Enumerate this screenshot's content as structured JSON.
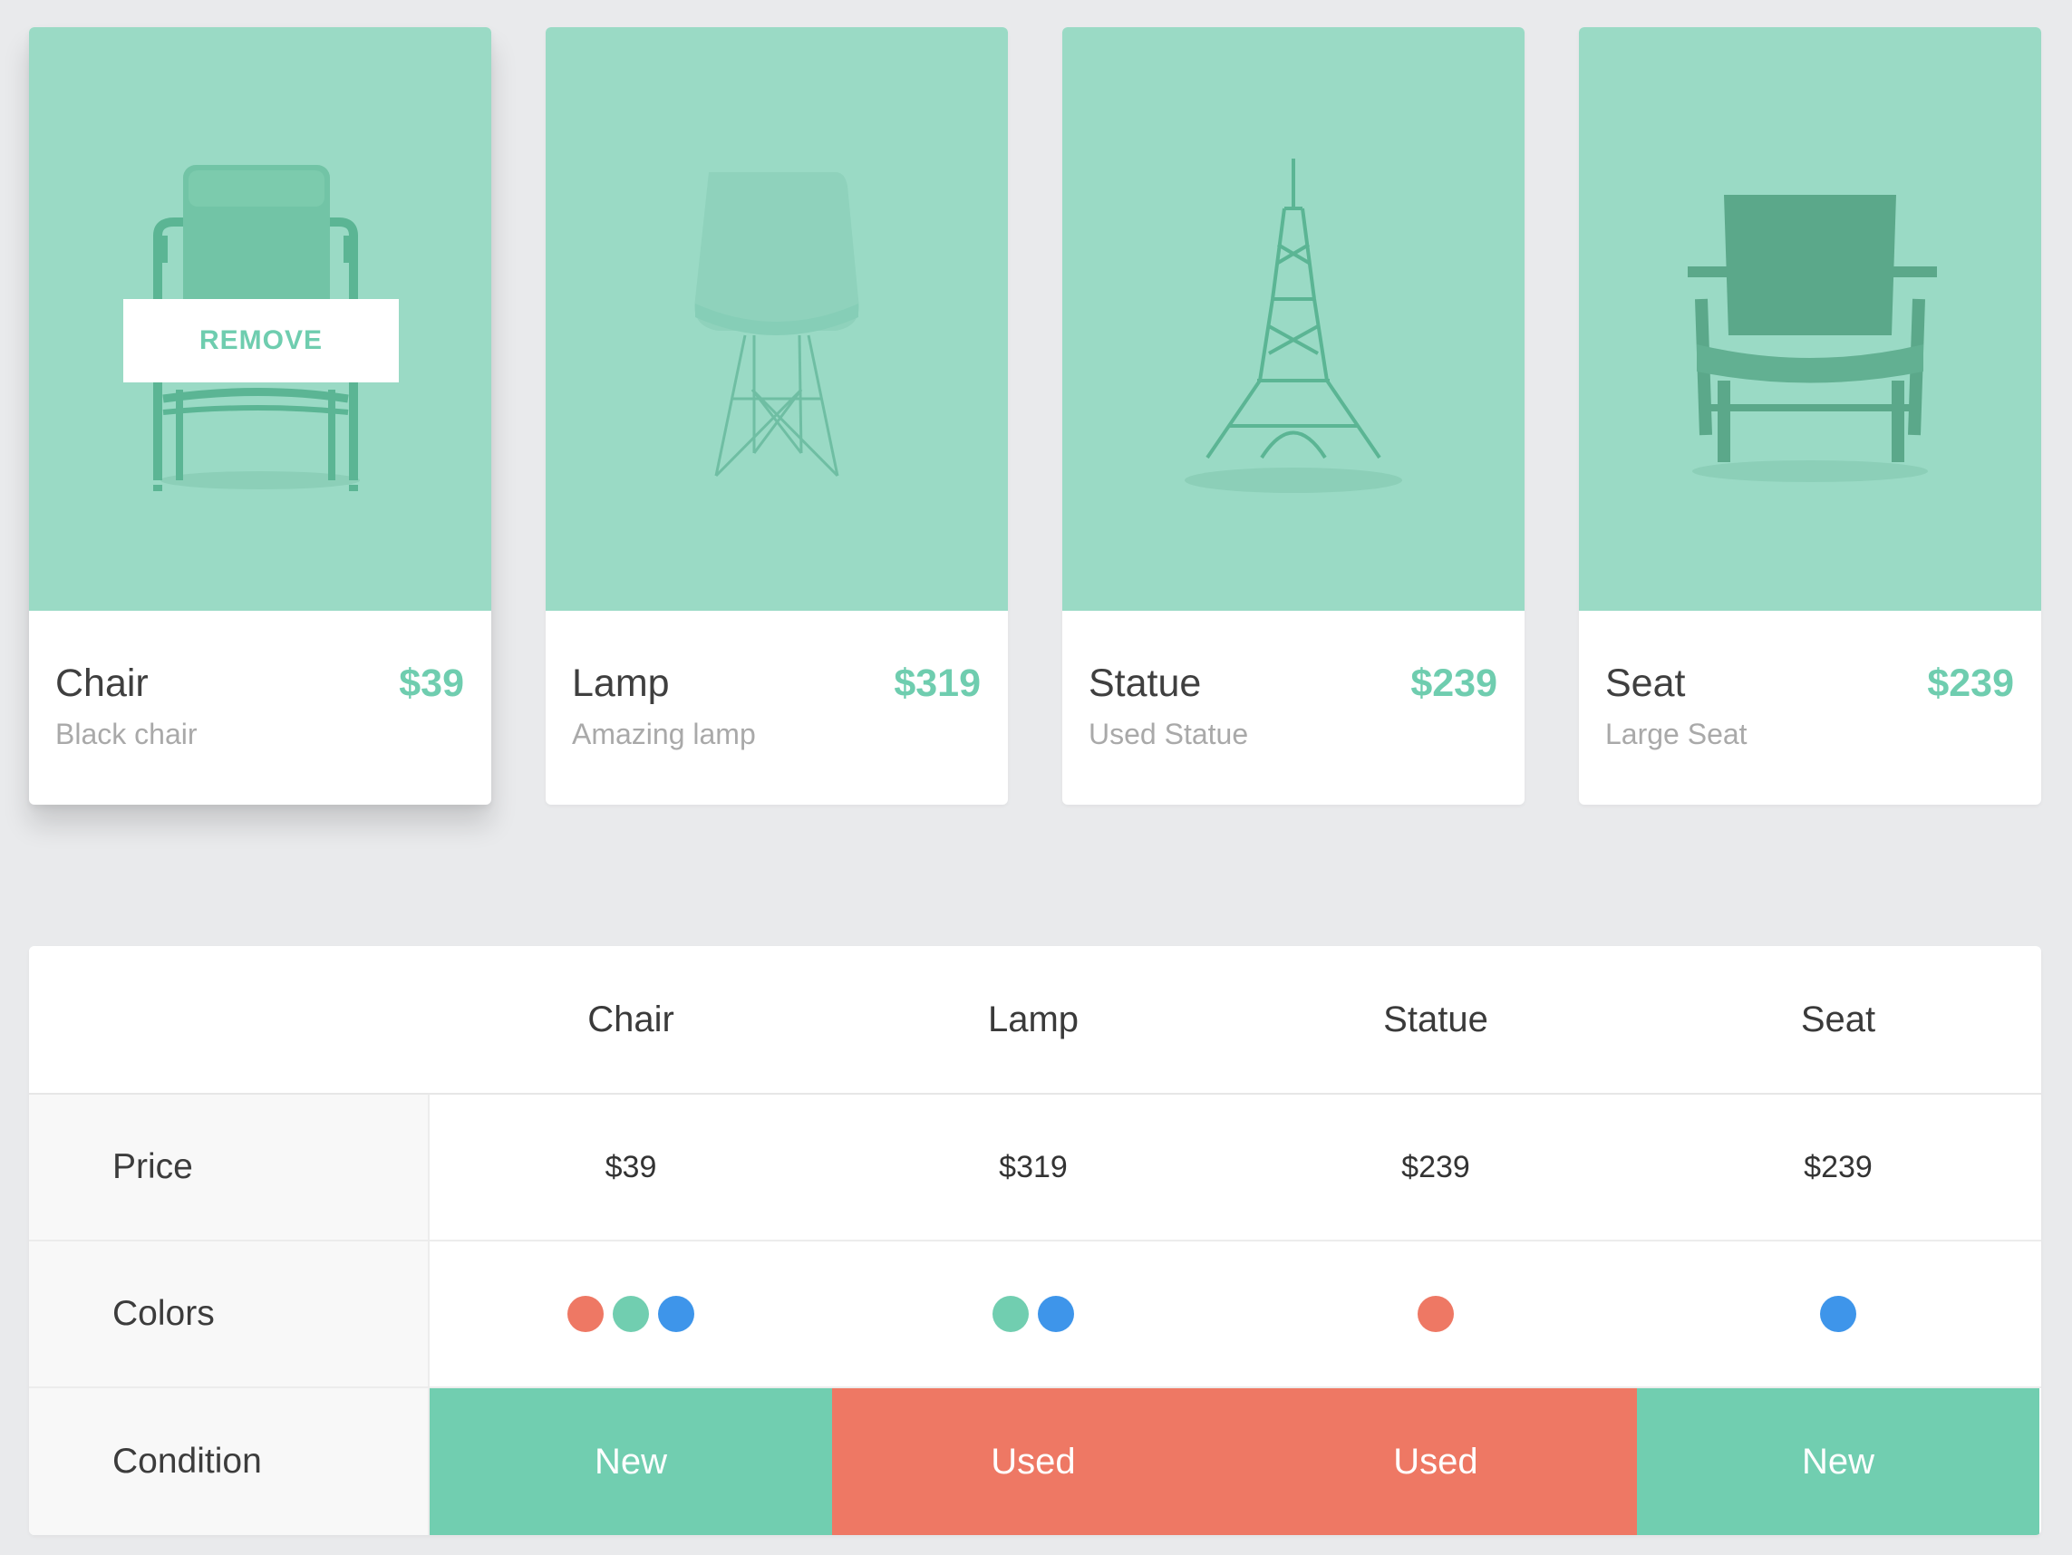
{
  "colors": {
    "background": "#e9eaec",
    "image_bg": "#9adac5",
    "accent": "#6fcdaf",
    "red": "#ee7864",
    "green": "#71ceb0",
    "blue": "#3e95ea"
  },
  "cards": [
    {
      "name": "Chair",
      "price": "$39",
      "desc": "Black chair",
      "icon": "armchair-icon"
    },
    {
      "name": "Lamp",
      "price": "$319",
      "desc": "Amazing lamp",
      "icon": "eames-chair-icon"
    },
    {
      "name": "Statue",
      "price": "$239",
      "desc": "Used Statue",
      "icon": "eiffel-tower-icon"
    },
    {
      "name": "Seat",
      "price": "$239",
      "desc": "Large Seat",
      "icon": "lounge-chair-icon"
    }
  ],
  "remove_label": "REMOVE",
  "table": {
    "columns": [
      "Chair",
      "Lamp",
      "Statue",
      "Seat"
    ],
    "row_labels": {
      "price": "Price",
      "colors": "Colors",
      "condition": "Condition"
    },
    "prices": [
      "$39",
      "$319",
      "$239",
      "$239"
    ],
    "colors": [
      [
        "red",
        "green",
        "blue"
      ],
      [
        "green",
        "blue"
      ],
      [
        "red"
      ],
      [
        "blue"
      ]
    ],
    "conditions": [
      {
        "label": "New",
        "color": "green"
      },
      {
        "label": "Used",
        "color": "red"
      },
      {
        "label": "Used",
        "color": "red"
      },
      {
        "label": "New",
        "color": "green"
      }
    ]
  }
}
